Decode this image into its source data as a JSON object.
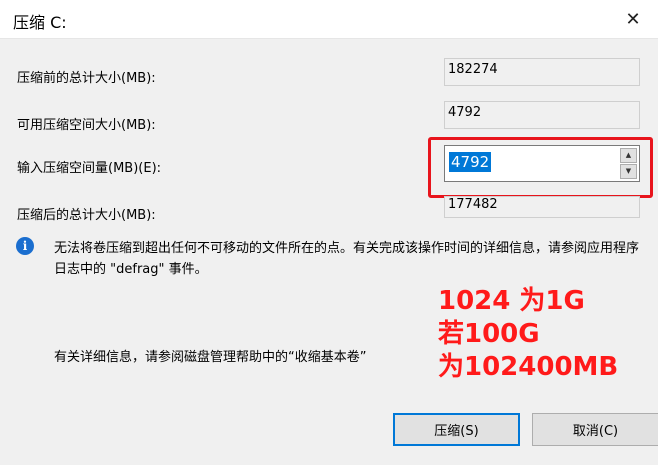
{
  "window": {
    "title": "压缩 C:",
    "close_glyph": "✕"
  },
  "fields": {
    "total_before_label": "压缩前的总计大小(MB):",
    "total_before_value": "182274",
    "available_label": "可用压缩空间大小(MB):",
    "available_value": "4792",
    "input_label": "输入压缩空间量(MB)(E):",
    "input_value": "4792",
    "total_after_label": "压缩后的总计大小(MB):",
    "total_after_value": "177482"
  },
  "spin": {
    "up_glyph": "▲",
    "down_glyph": "▼"
  },
  "info": {
    "icon_glyph": "i",
    "text": "无法将卷压缩到超出任何不可移动的文件所在的点。有关完成该操作时间的详细信息，请参阅应用程序日志中的 \"defrag\" 事件。",
    "note": "有关详细信息，请参阅磁盘管理帮助中的“收缩基本卷”"
  },
  "annotation": {
    "line1": "1024 为1G",
    "line2": "若100G",
    "line3": "为102400MB",
    "color": "#ff1a1a"
  },
  "buttons": {
    "shrink_label": "压缩(S)",
    "cancel_label": "取消(C)"
  },
  "colors": {
    "accent": "#0078d7",
    "highlight_frame": "#e8141c"
  }
}
